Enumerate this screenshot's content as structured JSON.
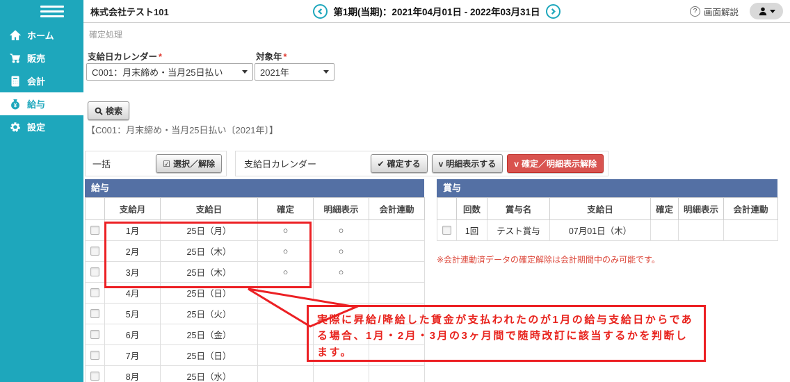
{
  "header": {
    "company_name": "株式会社テスト101",
    "period_label": "第1期(当期)：2021年04月01日 - 2022年03月31日",
    "help_label": "画面解説"
  },
  "sidebar": {
    "items": [
      {
        "id": "home",
        "label": "ホーム",
        "icon": "home-icon",
        "selected": false
      },
      {
        "id": "sales",
        "label": "販売",
        "icon": "cart-icon",
        "selected": false
      },
      {
        "id": "accounting",
        "label": "会計",
        "icon": "calculator-icon",
        "selected": false
      },
      {
        "id": "payroll",
        "label": "給与",
        "icon": "moneybag-icon",
        "selected": true
      },
      {
        "id": "settings",
        "label": "設定",
        "icon": "gear-icon",
        "selected": false
      }
    ]
  },
  "page": {
    "breadcrumb": "確定処理"
  },
  "filters": {
    "calendar_label": "支給日カレンダー",
    "calendar_value": "C001：月末締め・当月25日払い",
    "year_label": "対象年",
    "year_value": "2021年",
    "required_mark": "*",
    "search_button": "検索",
    "result_title": "【C001：月末締め・当月25日払い〔2021年〕】"
  },
  "toolbar": {
    "bulk_label": "一括",
    "select_toggle_label": "選択／解除",
    "select_toggle_glyph": "☑",
    "calendar_group_label": "支給日カレンダー",
    "confirm_label": "確定する",
    "confirm_glyph": "✔",
    "detail_show_label": "明細表示する",
    "detail_show_glyph": "v",
    "release_label": "確定／明細表示解除",
    "release_glyph": "v"
  },
  "salary_table": {
    "title": "給与",
    "headers": [
      "支給月",
      "支給日",
      "確定",
      "明細表示",
      "会計連動"
    ],
    "rows": [
      {
        "month": "1月",
        "date": "25日（月）",
        "confirmed": "○",
        "detail": "○",
        "accounting": ""
      },
      {
        "month": "2月",
        "date": "25日（木）",
        "confirmed": "○",
        "detail": "○",
        "accounting": ""
      },
      {
        "month": "3月",
        "date": "25日（木）",
        "confirmed": "○",
        "detail": "○",
        "accounting": ""
      },
      {
        "month": "4月",
        "date": "25日（日）",
        "confirmed": "",
        "detail": "",
        "accounting": ""
      },
      {
        "month": "5月",
        "date": "25日（火）",
        "confirmed": "",
        "detail": "",
        "accounting": ""
      },
      {
        "month": "6月",
        "date": "25日（金）",
        "confirmed": "",
        "detail": "",
        "accounting": ""
      },
      {
        "month": "7月",
        "date": "25日（日）",
        "confirmed": "",
        "detail": "",
        "accounting": ""
      },
      {
        "month": "8月",
        "date": "25日（水）",
        "confirmed": "",
        "detail": "",
        "accounting": ""
      }
    ]
  },
  "bonus_table": {
    "title": "賞与",
    "headers": [
      "回数",
      "賞与名",
      "支給日",
      "確定",
      "明細表示",
      "会計連動"
    ],
    "rows": [
      {
        "count": "1回",
        "name": "テスト賞与",
        "date": "07月01日（木）",
        "confirmed": "",
        "detail": "",
        "accounting": ""
      }
    ],
    "note": "※会計連動済データの確定解除は会計期間中のみ可能です。"
  },
  "annotation": {
    "text": "実際に昇給/降給した賃金が支払われたのが1月の給与支給日からである場合、1月・2月・3月の3ヶ月間で随時改訂に該当するかを判断します。"
  },
  "colors": {
    "accent_teal": "#1ea7bc",
    "table_header_blue": "#5470a4",
    "danger_button": "#d9534f",
    "annotation_red": "#ec2024",
    "note_red": "#dc4639"
  }
}
